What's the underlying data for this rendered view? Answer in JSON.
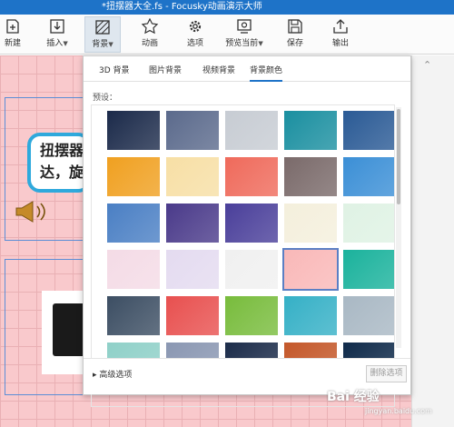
{
  "title": "*扭摆器大全.fs - Focusky动画演示大师",
  "toolbar": [
    {
      "label": "新建",
      "icon": "new-file-icon"
    },
    {
      "label": "插入",
      "icon": "insert-icon",
      "dropdown": true
    },
    {
      "label": "背景",
      "icon": "background-icon",
      "dropdown": true,
      "active": true
    },
    {
      "label": "动画",
      "icon": "animation-star-icon"
    },
    {
      "label": "选项",
      "icon": "gear-icon"
    },
    {
      "label": "预览当前",
      "icon": "preview-icon",
      "dropdown": true
    },
    {
      "label": "保存",
      "icon": "save-icon"
    },
    {
      "label": "输出",
      "icon": "export-icon"
    }
  ],
  "canvas": {
    "bubble_text": "扭摆器达，旋"
  },
  "panel": {
    "tabs": [
      "3D 背景",
      "图片背景",
      "视频背景",
      "背景颜色"
    ],
    "active_tab": "背景颜色",
    "preset_label": "预设：",
    "advanced_label": "高级选项",
    "delete_button": "删除选项",
    "swatches": [
      [
        "#1b2a4a",
        "#5b6a8c",
        "#c7ccd3",
        "#1a8fa0",
        "#2a5a95"
      ],
      [
        "#f0a020",
        "#f7dfa5",
        "#ef6a5b",
        "#7a6a6a",
        "#3b8fd6"
      ],
      [
        "#4a7fc4",
        "#4a3a8a",
        "#4a3f9a",
        "#f4efdc",
        "#dff2e4"
      ],
      [
        "#f4dbe6",
        "#e4dbf0",
        "#f0f0f0",
        "#f9b8b8",
        "#1ab29c"
      ],
      [
        "#3c4e63",
        "#e8504f",
        "#78bc3c",
        "#35b0c6",
        "#a9b8c4"
      ],
      [
        "#8fd0c8",
        "#8a97b2",
        "#1c2c4a",
        "#c4582a",
        "#0f2a4a"
      ]
    ],
    "selected_swatch": "#f9b8b8"
  },
  "watermark": {
    "main": "Bai 经验",
    "sub": "jingyan.baidu.com"
  }
}
